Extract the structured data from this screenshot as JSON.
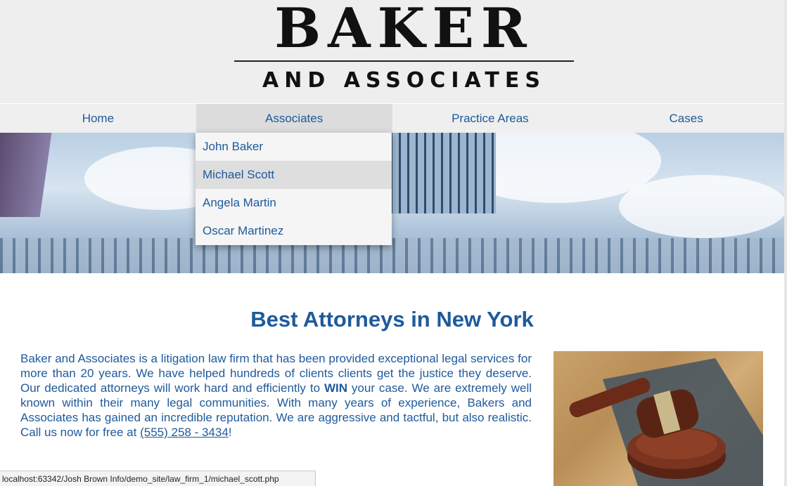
{
  "logo": {
    "title": "BAKER",
    "subtitle": "AND ASSOCIATES"
  },
  "nav": {
    "items": [
      {
        "label": "Home"
      },
      {
        "label": "Associates"
      },
      {
        "label": "Practice Areas"
      },
      {
        "label": "Cases"
      }
    ],
    "active_index": 1
  },
  "dropdown": {
    "items": [
      {
        "label": "John Baker"
      },
      {
        "label": "Michael Scott"
      },
      {
        "label": "Angela Martin"
      },
      {
        "label": "Oscar Martinez"
      }
    ],
    "hover_index": 1
  },
  "main": {
    "headline": "Best Attorneys in New York",
    "paragraph_part1": "Baker and Associates is a litigation law firm that has been provided exceptional legal services for more than 20 years. We have helped hundreds of clients clients get the justice they deserve. Our dedicated attorneys will work hard and efficiently to ",
    "paragraph_bold": "WIN",
    "paragraph_part2": " your case. We are extremely well known within their many legal communities. With many years of experience, Bakers and Associates has gained an incredible reputation. We are aggressive and tactful, but also realistic. Call us now for free at ",
    "phone": "(555) 258 - 3434",
    "paragraph_end": "!"
  },
  "status": {
    "url": "localhost:63342/Josh Brown Info/demo_site/law_firm_1/michael_scott.php"
  },
  "colors": {
    "accent": "#1e5a9c",
    "header_bg": "#eeeeee",
    "nav_bg": "#efefef"
  }
}
